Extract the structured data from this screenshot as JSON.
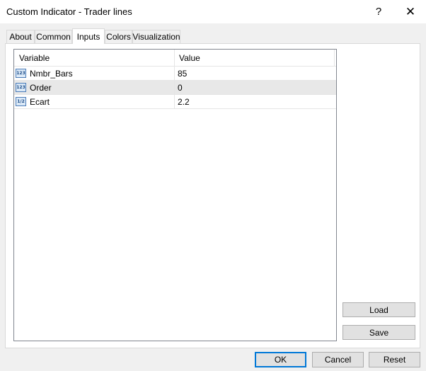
{
  "window": {
    "title": "Custom Indicator - Trader lines"
  },
  "titlebar": {
    "help_glyph": "?",
    "close_glyph": "✕"
  },
  "tabs": [
    {
      "label": "About"
    },
    {
      "label": "Common"
    },
    {
      "label": "Inputs",
      "active": true
    },
    {
      "label": "Colors"
    },
    {
      "label": "Visualization"
    }
  ],
  "inputs_table": {
    "columns": [
      "Variable",
      "Value"
    ],
    "rows": [
      {
        "icon": "integer-type-icon",
        "icon_text": "123",
        "variable": "Nmbr_Bars",
        "value": "85"
      },
      {
        "icon": "integer-type-icon",
        "icon_text": "123",
        "variable": "Order",
        "value": "0"
      },
      {
        "icon": "double-type-icon",
        "icon_text": "1/2",
        "variable": "Ecart",
        "value": "2.2"
      }
    ]
  },
  "side_buttons": {
    "load": "Load",
    "save": "Save"
  },
  "footer_buttons": {
    "ok": "OK",
    "cancel": "Cancel",
    "reset": "Reset"
  },
  "colors": {
    "accent": "#0078d7",
    "selected_row": "#e8e8e8"
  }
}
